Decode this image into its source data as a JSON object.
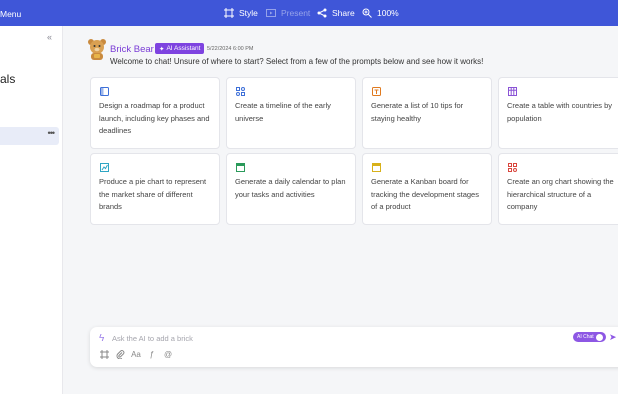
{
  "topbar": {
    "menu_label": "Menu",
    "style_label": "Style",
    "present_label": "Present",
    "share_label": "Share",
    "zoom_label": "100%"
  },
  "sidebar": {
    "title": "als",
    "collapse_glyph": "«",
    "row_more": "•••"
  },
  "chat": {
    "bot_name": "Brick Bear",
    "badge": "AI Assistant",
    "timestamp": "5/22/2024 6:00 PM",
    "welcome": "Welcome to chat! Unsure of where to start? Select from a few of the prompts below and see how it works!"
  },
  "prompts": [
    {
      "text": "Design a roadmap for a product launch, including key phases and deadlines",
      "icon": "roadmap-icon",
      "color": "#3d6fd8"
    },
    {
      "text": "Create a timeline of the early universe",
      "icon": "timeline-icon",
      "color": "#3d6fd8"
    },
    {
      "text": "Generate a list of 10 tips for staying healthy",
      "icon": "list-icon",
      "color": "#e07a1f"
    },
    {
      "text": "Create a table with countries by population",
      "icon": "table-icon",
      "color": "#8a53d6"
    },
    {
      "text": "Produce a pie chart to represent the market share of different brands",
      "icon": "pie-chart-icon",
      "color": "#2fa6c4"
    },
    {
      "text": "Generate a daily calendar to plan your tasks and activities",
      "icon": "calendar-icon",
      "color": "#2a9a5a"
    },
    {
      "text": "Generate a Kanban board for tracking the development stages of a product",
      "icon": "kanban-icon",
      "color": "#d8b11a"
    },
    {
      "text": "Create an org chart showing the hierarchical structure of a company",
      "icon": "org-chart-icon",
      "color": "#d9463d"
    }
  ],
  "composer": {
    "placeholder": "Ask the AI to add a brick",
    "ai_chat_label": "AI Chat",
    "text_tool": "Aa",
    "formula_tool": "ƒ",
    "mention_tool": "@"
  }
}
